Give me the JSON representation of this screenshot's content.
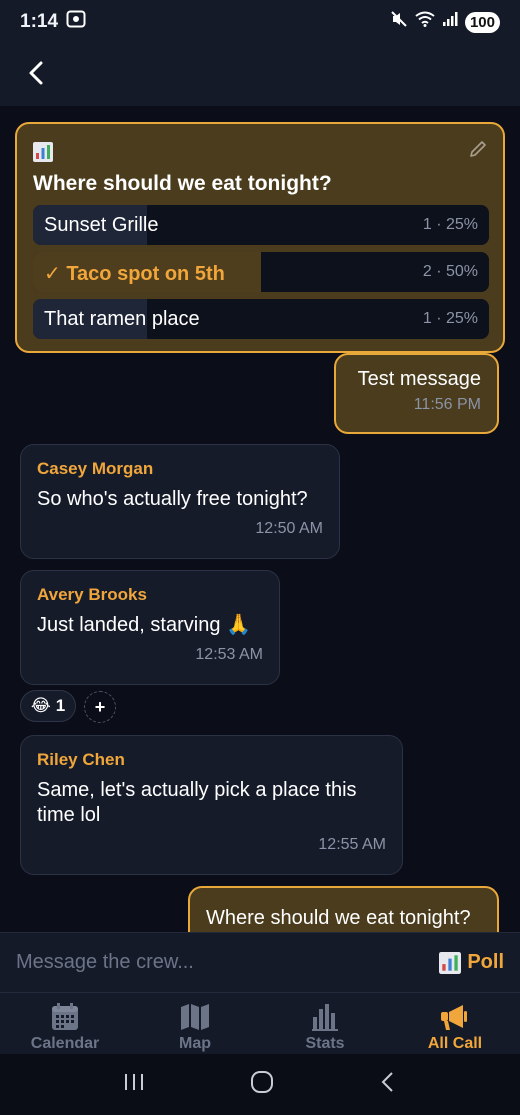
{
  "status_bar": {
    "time": "1:14",
    "battery": "100"
  },
  "poll": {
    "question": "Where should we eat tonight?",
    "options": [
      {
        "label": "Sunset Grille",
        "stat": "1 · 25%",
        "percent": 25,
        "selected": false
      },
      {
        "label": "✓ Taco spot on 5th",
        "stat": "2 · 50%",
        "percent": 50,
        "selected": true
      },
      {
        "label": "That ramen place",
        "stat": "1 · 25%",
        "percent": 25,
        "selected": false
      }
    ]
  },
  "messages": [
    {
      "text": "Test message",
      "time": "11:56 PM"
    },
    {
      "sender": "Casey Morgan",
      "text": "So who's actually free tonight?",
      "time": "12:50 AM"
    },
    {
      "sender": "Avery Brooks",
      "text": "Just landed, starving 🙏",
      "time": "12:53 AM"
    },
    {
      "sender": "Riley Chen",
      "text": "Same, let's actually pick a place this time lol",
      "time": "12:55 AM"
    },
    {
      "text": "Where should we eat tonight?"
    }
  ],
  "reaction": {
    "emoji": "😂",
    "count": "1",
    "add_label": "+"
  },
  "composer": {
    "placeholder": "Message the crew...",
    "poll_label": "Poll"
  },
  "nav": {
    "items": [
      {
        "label": "Calendar",
        "icon": "calendar-icon"
      },
      {
        "label": "Map",
        "icon": "map-icon"
      },
      {
        "label": "Stats",
        "icon": "stats-icon"
      },
      {
        "label": "All Call",
        "icon": "megaphone-icon",
        "active": true
      }
    ]
  },
  "colors": {
    "accent": "#f0a63a",
    "background": "#0b0e18",
    "surface": "#141a28",
    "bubble_incoming": "#161b2a",
    "bubble_outgoing": "#4a3c1c"
  }
}
